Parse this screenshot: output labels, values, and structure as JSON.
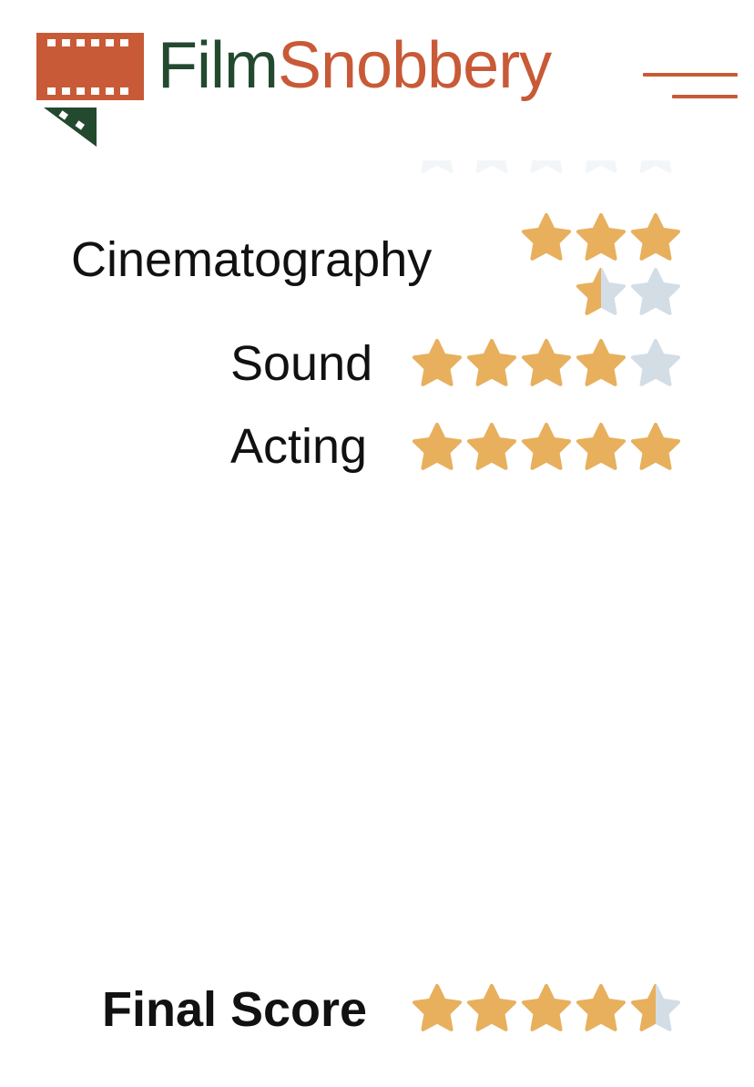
{
  "header": {
    "logo_left": "Film",
    "logo_right": "Snobbery",
    "menu_icon": "hamburger-menu-icon"
  },
  "colors": {
    "brand_green": "#23492f",
    "brand_orange": "#c85a37",
    "star_filled": "#e8b05c",
    "star_empty": "#d3dde6"
  },
  "ratings": [
    {
      "label": "Cinematography",
      "stars": 3.5,
      "max": 5
    },
    {
      "label": "Sound",
      "stars": 4,
      "max": 5
    },
    {
      "label": "Acting",
      "stars": 5,
      "max": 5
    }
  ],
  "final": {
    "label": "Final Score",
    "stars": 4.5,
    "max": 5
  }
}
